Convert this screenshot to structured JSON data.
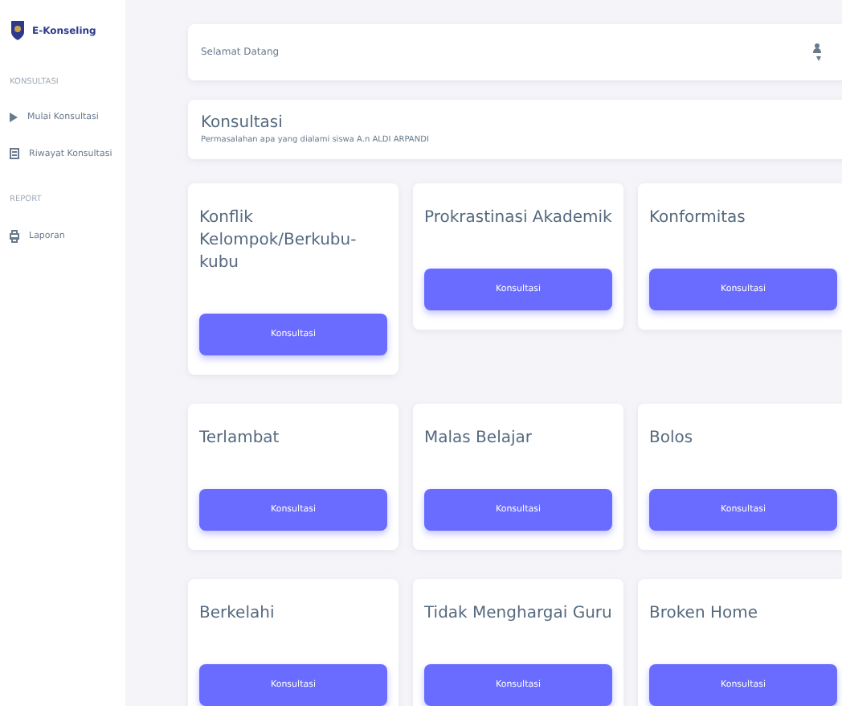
{
  "sidebar": {
    "logo_text": "E-Konseling",
    "sections": [
      {
        "heading": "KONSULTASI",
        "items": [
          {
            "kind": "play",
            "label": "Mulai Konsultasi"
          },
          {
            "kind": "list",
            "label": "Riwayat Konsultasi"
          }
        ]
      },
      {
        "heading": "REPORT",
        "items": [
          {
            "kind": "printer",
            "label": "Laporan"
          }
        ]
      }
    ]
  },
  "header": {
    "greeting": "Selamat Datang"
  },
  "intro": {
    "title": "Konsultasi",
    "subtitle": "Permasalahan apa yang dialami siswa A.n ALDI ARPANDI"
  },
  "cards": [
    {
      "title": "Konflik Kelompok/Berkubu-kubu",
      "button": "Konsultasi"
    },
    {
      "title": "Prokrastinasi Akademik",
      "button": "Konsultasi"
    },
    {
      "title": "Konformitas",
      "button": "Konsultasi"
    },
    {
      "title": "Terlambat",
      "button": "Konsultasi"
    },
    {
      "title": "Malas Belajar",
      "button": "Konsultasi"
    },
    {
      "title": "Bolos",
      "button": "Konsultasi"
    },
    {
      "title": "Berkelahi",
      "button": "Konsultasi"
    },
    {
      "title": "Tidak Menghargai Guru",
      "button": "Konsultasi"
    },
    {
      "title": "Broken Home",
      "button": "Konsultasi"
    }
  ]
}
